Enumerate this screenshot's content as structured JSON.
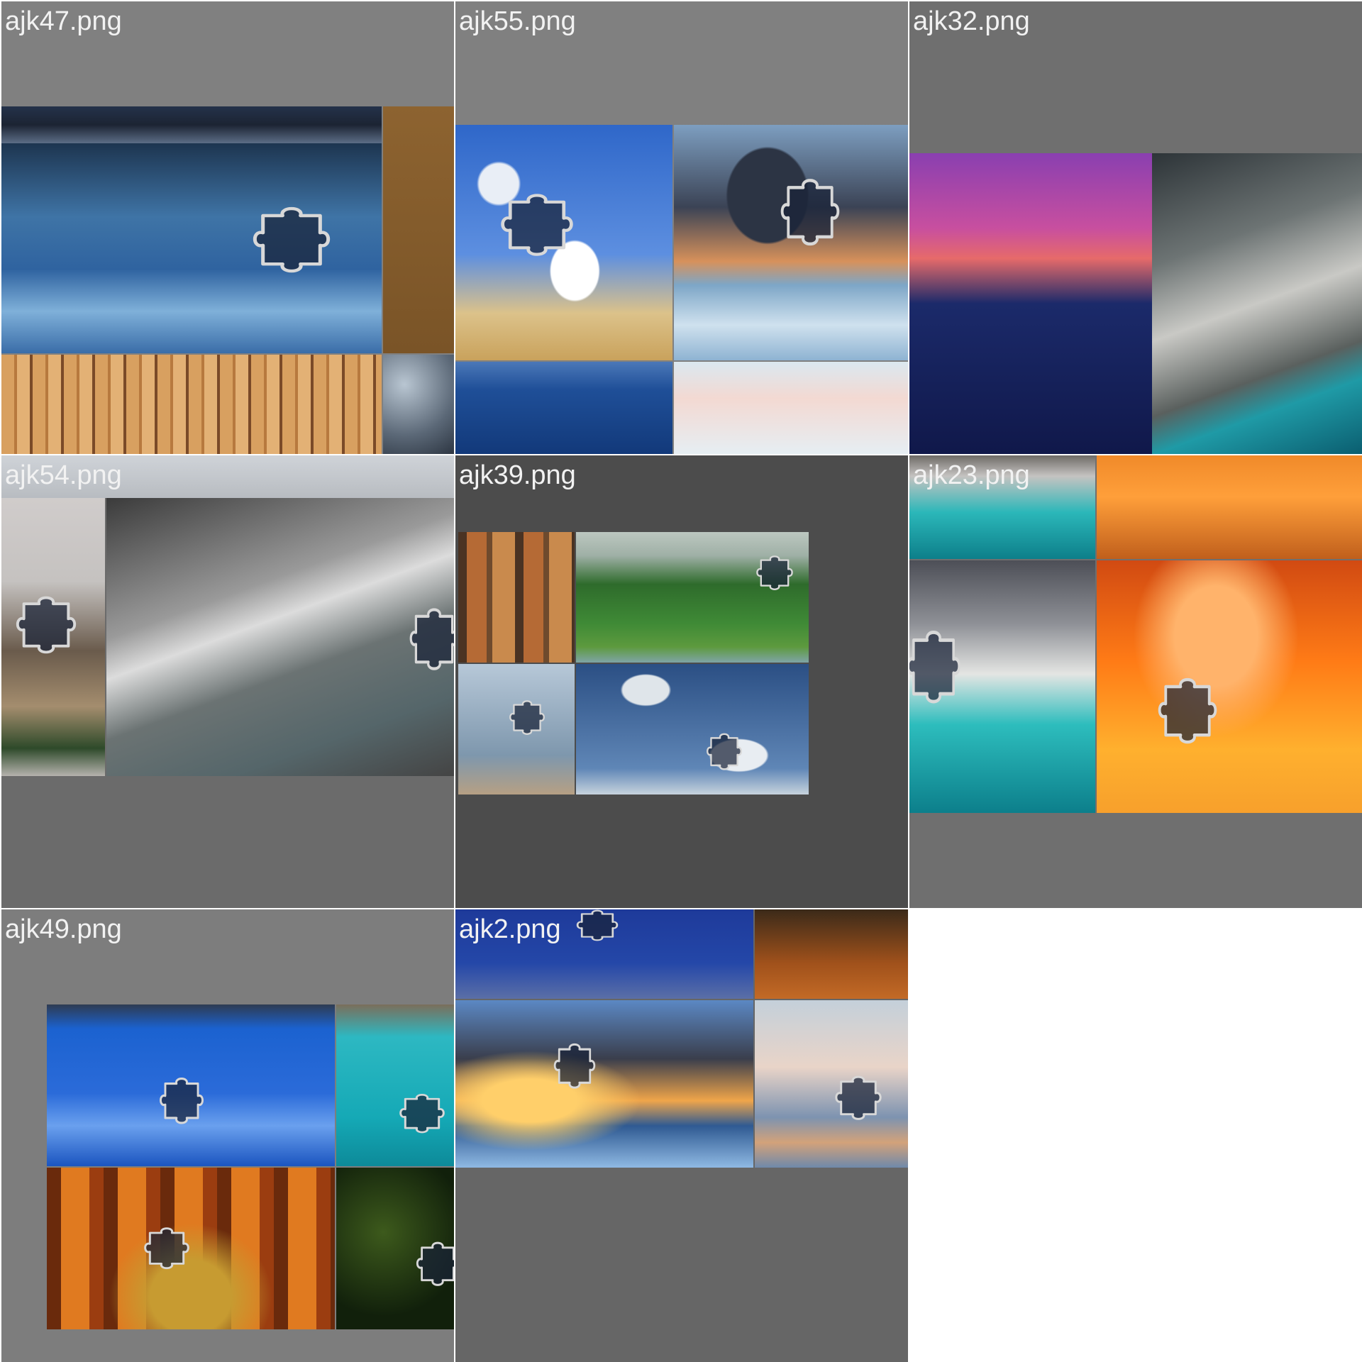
{
  "cells": [
    {
      "filename": "ajk47.png",
      "background": "#808080"
    },
    {
      "filename": "ajk55.png",
      "background": "#808080"
    },
    {
      "filename": "ajk32.png",
      "background": "#6f6f6f"
    },
    {
      "filename": "ajk54.png",
      "background": "#6b6b6b"
    },
    {
      "filename": "ajk39.png",
      "background": "#4c4c4c"
    },
    {
      "filename": "ajk23.png",
      "background": "#6f6f6f"
    },
    {
      "filename": "ajk49.png",
      "background": "#7d7d7d"
    },
    {
      "filename": "ajk2.png",
      "background": "#666666"
    }
  ],
  "colors": {
    "gutter": "#ffffff",
    "caption_text": "#f2f2f2",
    "piece_outline": "#d8d8d8"
  },
  "icons": {
    "missing_piece": "puzzle-piece-icon"
  }
}
